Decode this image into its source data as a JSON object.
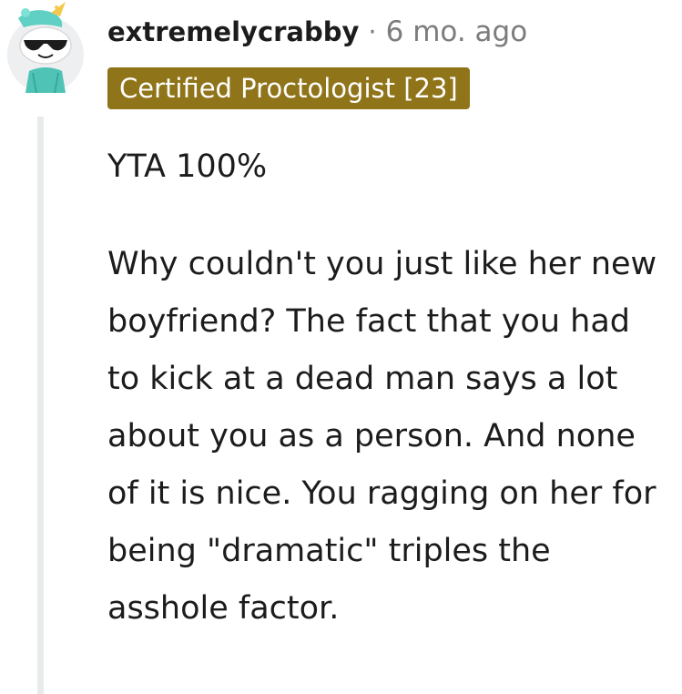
{
  "comment": {
    "author": "extremelycrabby",
    "separator": "·",
    "timestamp": "6 mo. ago",
    "flair": "Certified Proctologist [23]",
    "paragraphs": [
      "YTA 100%",
      "Why couldn't you just like her new boyfriend? The fact that you had to kick at a dead man says a lot about you as a person. And none of it is nice. You ragging on her for being \"dramatic\" triples the asshole factor."
    ]
  },
  "colors": {
    "flair_background": "#8f7419",
    "flair_text": "#ffffff",
    "thread_line": "#e9eaeb",
    "avatar_body": "#4fc3b5",
    "avatar_horn": "#f2c94c"
  },
  "icons": {
    "avatar": "snoo-avatar-with-sunglasses-and-unicorn-hat"
  }
}
